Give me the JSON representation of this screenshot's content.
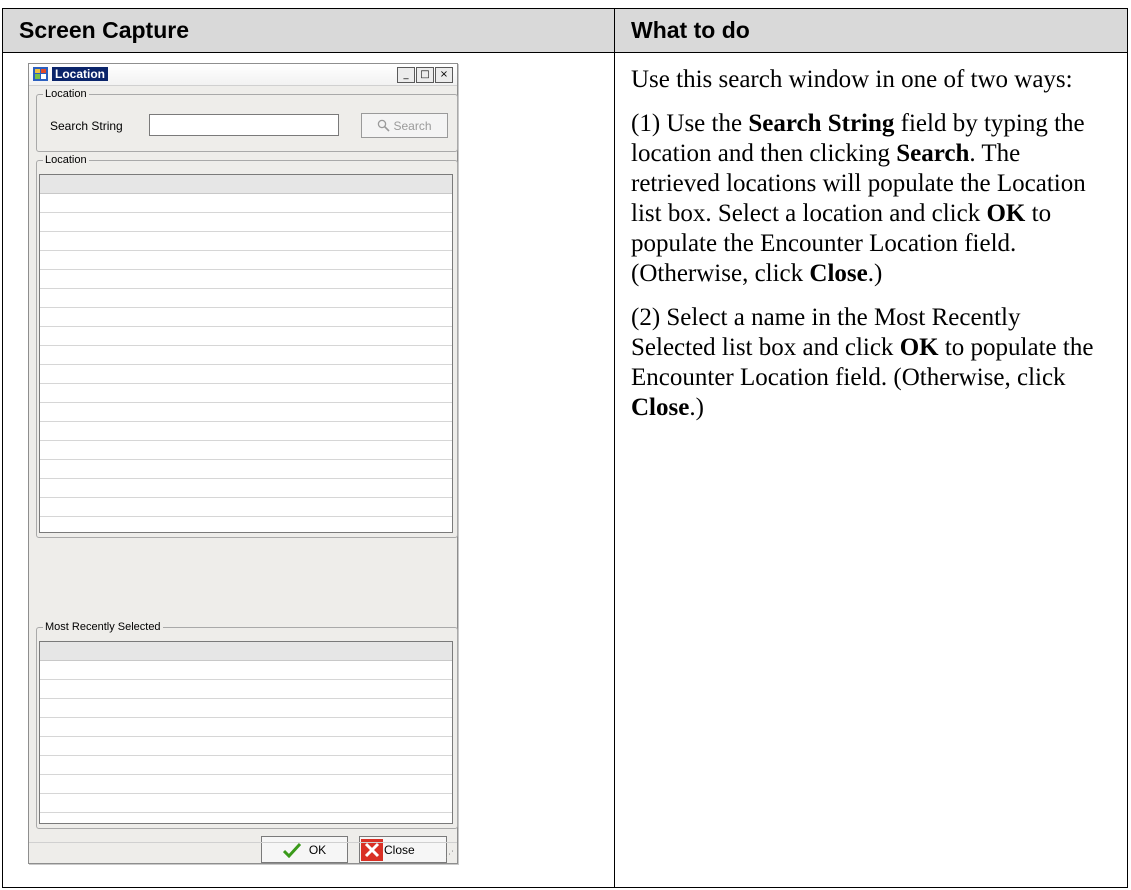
{
  "header": {
    "col1": "Screen Capture",
    "col2": "What to do"
  },
  "window": {
    "title": "Location",
    "minimize": "_",
    "maximize": "□",
    "close": "×",
    "search_group_label": "Location",
    "search_label": "Search String",
    "search_input_value": "",
    "search_button": "Search",
    "location_group_label": "Location",
    "recent_group_label": "Most Recently Selected",
    "ok_button": "OK",
    "close_button": "Close",
    "icons": {
      "app": "app-icon",
      "search": "magnifier-icon",
      "ok": "checkmark-icon",
      "close": "red-x-icon"
    }
  },
  "instructions": {
    "p1": "Use this search window in one of two ways:",
    "p2_a": "(1) Use the ",
    "p2_b": "Search String",
    "p2_c": " field by typing the location and then clicking ",
    "p2_d": "Search",
    "p2_e": ". The retrieved locations will populate the Location list box. Select a location and click ",
    "p2_f": "OK",
    "p2_g": " to populate the Encounter Location field. (Otherwise, click ",
    "p2_h": "Close",
    "p2_i": ".)",
    "p3_a": "(2) Select a name in the Most Recently Selected list box and click ",
    "p3_b": "OK",
    "p3_c": " to populate the Encounter Location field. (Otherwise, click ",
    "p3_d": "Close",
    "p3_e": ".)"
  },
  "colors": {
    "title_highlight": "#0a246a",
    "window_bg": "#eeedea",
    "ok_green": "#3a9a1a",
    "close_red": "#d93025"
  }
}
